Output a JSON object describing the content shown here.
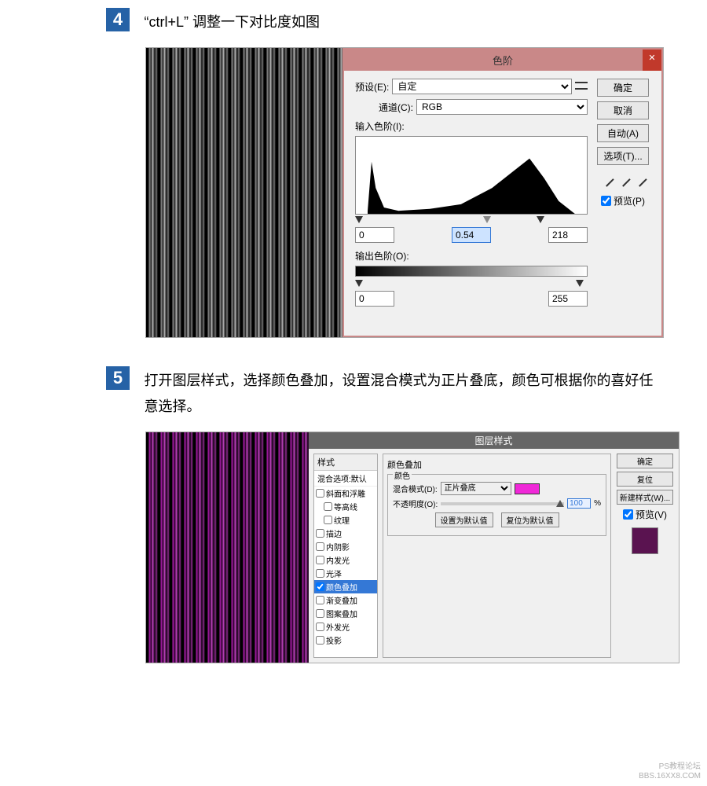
{
  "step4": {
    "num": "4",
    "text": "“ctrl+L” 调整一下对比度如图",
    "levels": {
      "title": "色阶",
      "preset_label": "预设(E):",
      "preset_value": "自定",
      "channel_label": "通道(C):",
      "channel_value": "RGB",
      "input_label": "输入色阶(I):",
      "black": "0",
      "gamma": "0.54",
      "white": "218",
      "output_label": "输出色阶(O):",
      "out_black": "0",
      "out_white": "255",
      "ok": "确定",
      "cancel": "取消",
      "auto": "自动(A)",
      "options": "选项(T)...",
      "preview": "预览(P)"
    }
  },
  "step5": {
    "num": "5",
    "text": "打开图层样式，选择颜色叠加，设置混合模式为正片叠底，颜色可根据你的喜好任意选择。",
    "layerstyle": {
      "title": "图层样式",
      "styles_header": "样式",
      "blend_default": "混合选项:默认",
      "items": [
        "斜面和浮雕",
        "等高线",
        "纹理",
        "描边",
        "内阴影",
        "内发光",
        "光泽",
        "颜色叠加",
        "渐变叠加",
        "图案叠加",
        "外发光",
        "投影"
      ],
      "overlay_title": "颜色叠加",
      "color_label": "颜色",
      "blend_label": "混合模式(D):",
      "blend_value": "正片叠底",
      "opacity_label": "不透明度(O):",
      "opacity_value": "100",
      "pct": "%",
      "btn_default": "设置为默认值",
      "btn_reset": "复位为默认值",
      "ok": "确定",
      "cancel": "复位",
      "newstyle": "新建样式(W)...",
      "preview": "预览(V)"
    }
  },
  "watermark": {
    "line1": "PS教程论坛",
    "line2": "BBS.16XX8.COM"
  }
}
